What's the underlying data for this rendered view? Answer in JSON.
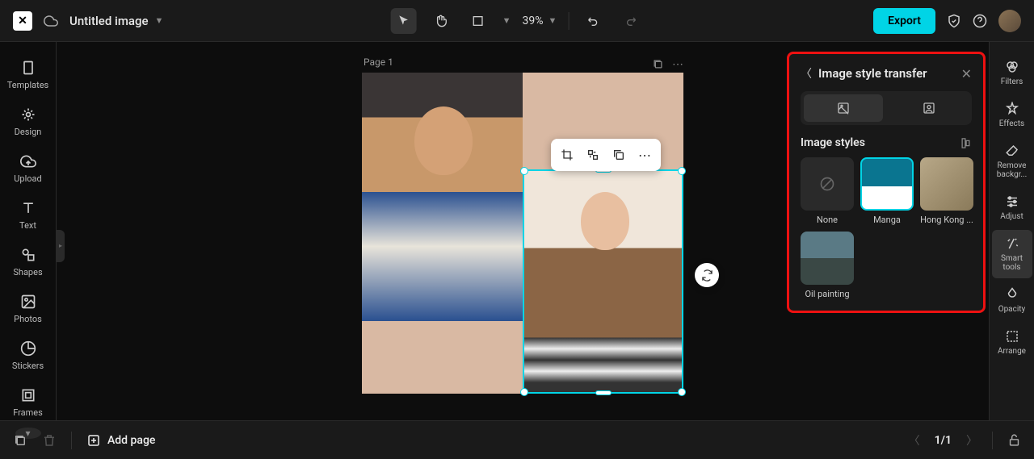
{
  "header": {
    "title": "Untitled image",
    "zoom": "39%",
    "export_label": "Export"
  },
  "left_sidebar": {
    "items": [
      {
        "label": "Templates"
      },
      {
        "label": "Design"
      },
      {
        "label": "Upload"
      },
      {
        "label": "Text"
      },
      {
        "label": "Shapes"
      },
      {
        "label": "Photos"
      },
      {
        "label": "Stickers"
      },
      {
        "label": "Frames"
      }
    ]
  },
  "right_sidebar": {
    "items": [
      {
        "label": "Filters"
      },
      {
        "label": "Effects"
      },
      {
        "label": "Remove backgr..."
      },
      {
        "label": "Adjust"
      },
      {
        "label": "Smart tools"
      },
      {
        "label": "Opacity"
      },
      {
        "label": "Arrange"
      }
    ]
  },
  "canvas": {
    "page_label": "Page 1"
  },
  "panel": {
    "title": "Image style transfer",
    "subtitle": "Image styles",
    "styles": [
      {
        "label": "None"
      },
      {
        "label": "Manga"
      },
      {
        "label": "Hong Kong ..."
      },
      {
        "label": "Oil painting"
      }
    ]
  },
  "bottombar": {
    "add_page": "Add page",
    "page_count": "1/1"
  }
}
